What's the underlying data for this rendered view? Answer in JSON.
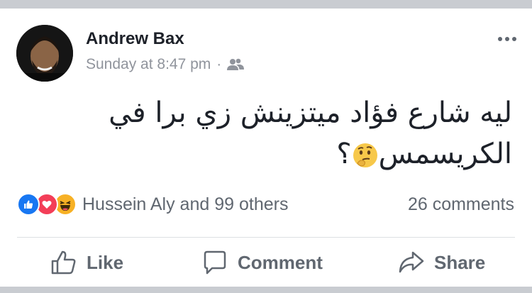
{
  "post": {
    "author": "Andrew Bax",
    "time": "Sunday at 8:47 pm",
    "separator": "·",
    "audience_icon": "friends-icon",
    "text_line1": "ليه شارع فؤاد ميتزينش زي برا في",
    "text_line2": "الكريسمس",
    "text_emoji": "thinking-face-emoji",
    "text_end": "؟"
  },
  "stats": {
    "reactions": [
      "like",
      "love",
      "haha"
    ],
    "reaction_text": "Hussein Aly and 99 others",
    "comments_text": "26 comments"
  },
  "actions": {
    "like_label": "Like",
    "comment_label": "Comment",
    "share_label": "Share"
  },
  "colors": {
    "like_blue": "#1877f2",
    "love_red": "#f33e58",
    "haha_yellow": "#f7b125",
    "secondary_text": "#606770"
  }
}
